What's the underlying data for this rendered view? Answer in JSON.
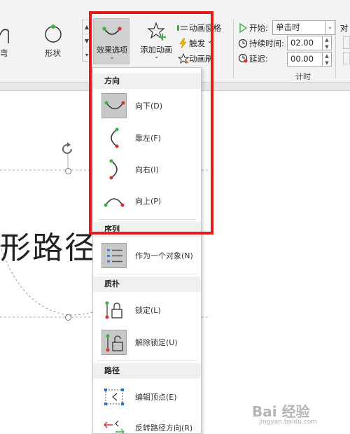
{
  "ribbon": {
    "arc_label": "弯",
    "shape_label": "形状",
    "effect_options": "效果选项",
    "add_animation": "添加动画",
    "animation_pane": "动画窗格",
    "trigger": "触发",
    "animation_painter": "动画刷",
    "start_label": "开始:",
    "start_value": "单击时",
    "duration_label": "持续时间:",
    "duration_value": "02.00",
    "delay_label": "延迟:",
    "delay_value": "00.00",
    "timing_group": "计时",
    "align_partial": "对"
  },
  "slide": {
    "text": "形路径"
  },
  "menu": {
    "direction_header": "方向",
    "directions": [
      {
        "label": "向下(D)",
        "icon": "arc-down-icon",
        "selected": true
      },
      {
        "label": "靠左(F)",
        "icon": "arc-left-icon",
        "selected": false
      },
      {
        "label": "向右(I)",
        "icon": "arc-right-icon",
        "selected": false
      },
      {
        "label": "向上(P)",
        "icon": "arc-up-icon",
        "selected": false
      }
    ],
    "sequence_header": "序列",
    "sequence_item": "作为一个对象(N)",
    "origin_header": "质朴",
    "lock": "锁定(L)",
    "unlock": "解除锁定(U)",
    "path_header": "路径",
    "edit_points": "编辑顶点(E)",
    "reverse_path": "反转路径方向(R)"
  },
  "colors": {
    "highlight_border": "#e31b1b",
    "start_point": "#3cb043",
    "end_point": "#d93030"
  },
  "watermark": {
    "text": "Bai 经验",
    "url": "jingyan.baidu.com"
  }
}
